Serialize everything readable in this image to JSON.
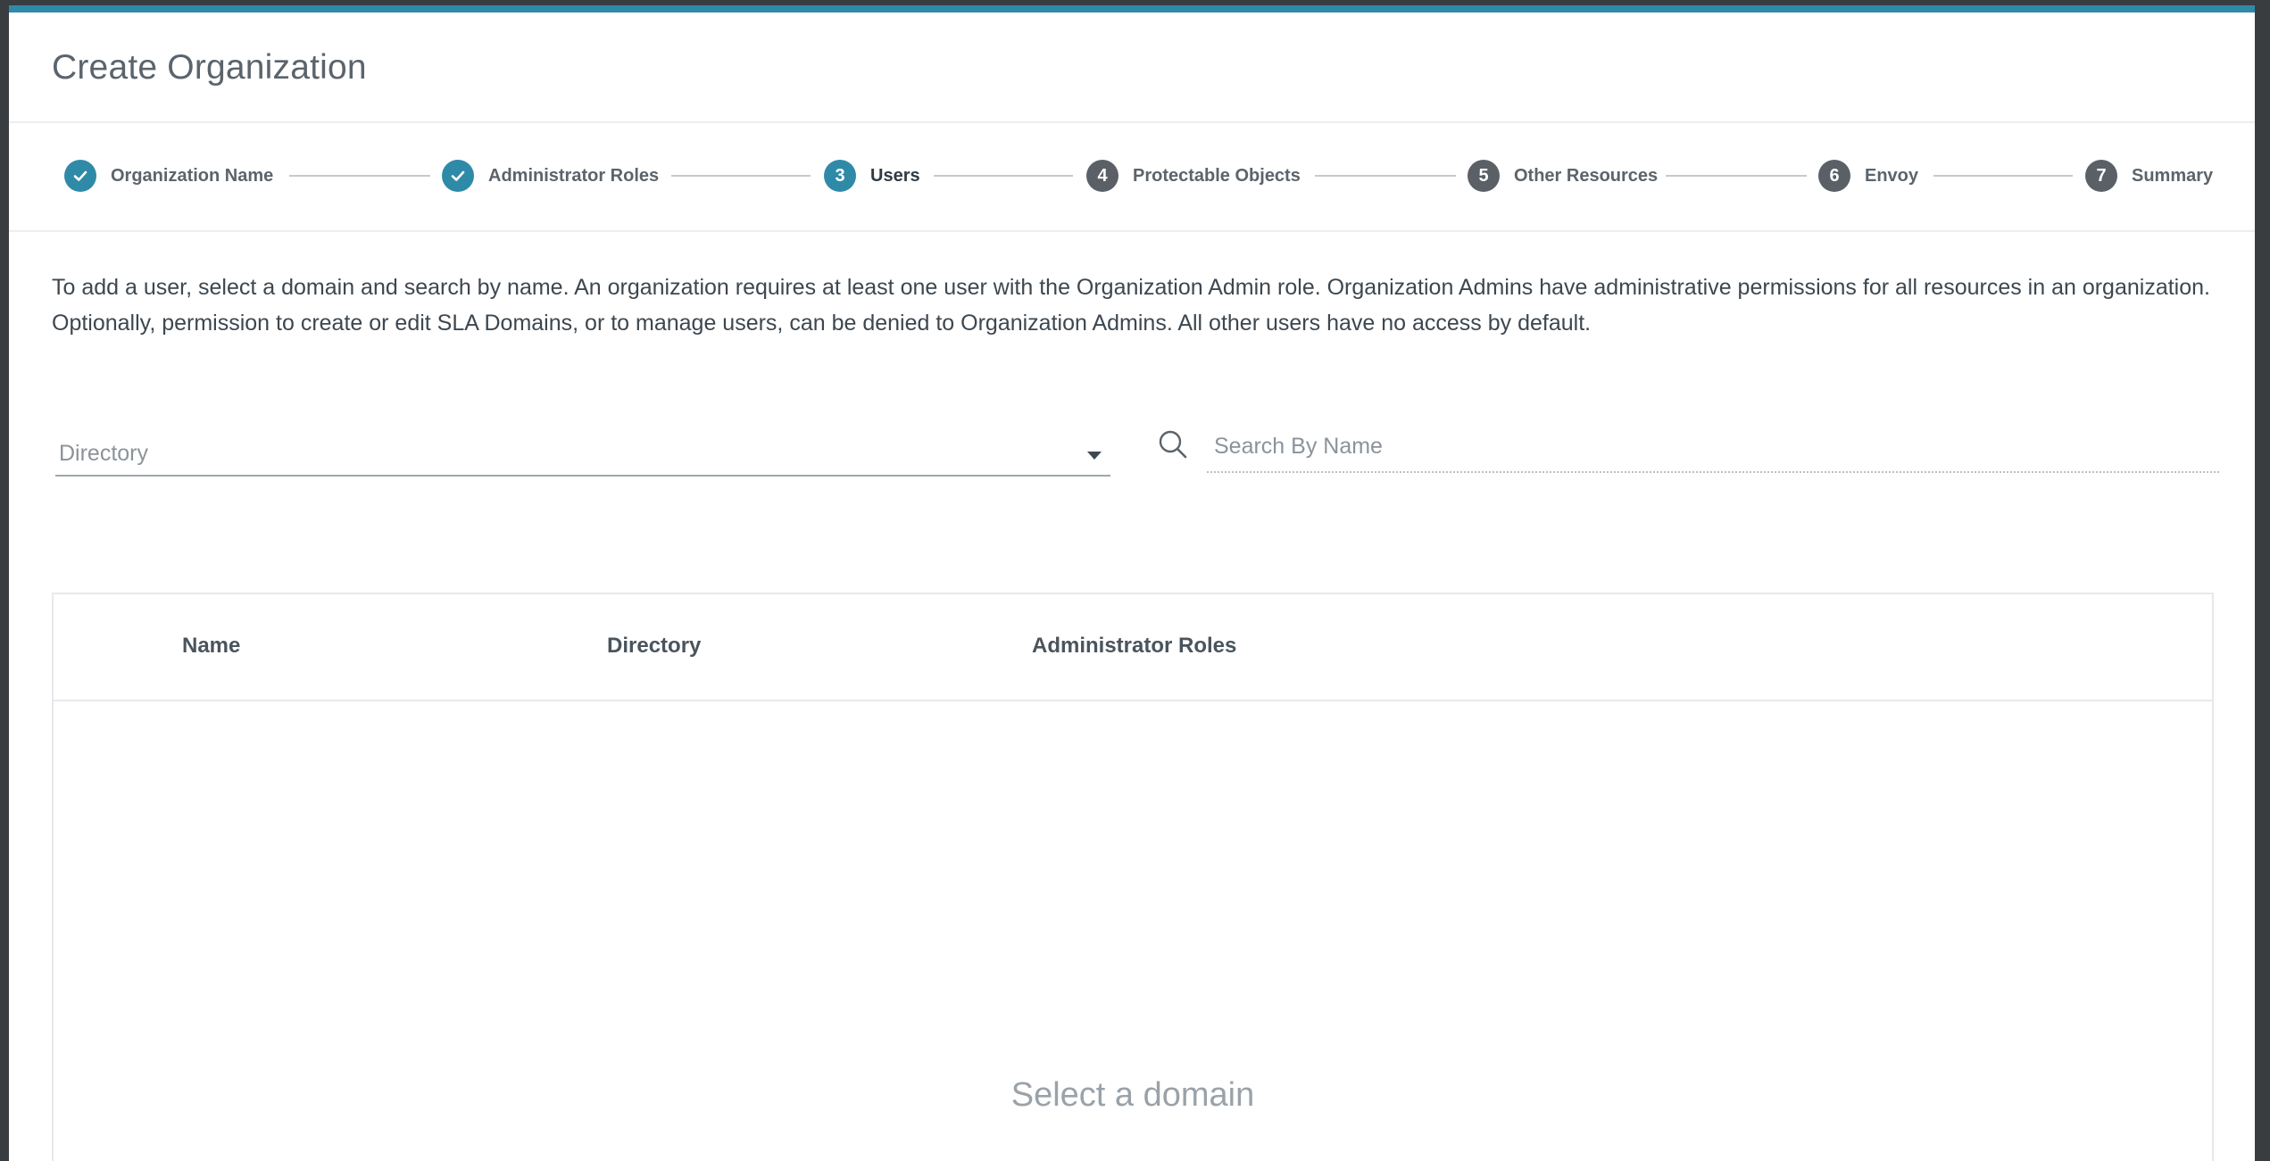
{
  "modal": {
    "title": "Create Organization"
  },
  "stepper": {
    "steps": [
      {
        "label": "Organization Name",
        "state": "done",
        "number": "1"
      },
      {
        "label": "Administrator Roles",
        "state": "done",
        "number": "2"
      },
      {
        "label": "Users",
        "state": "active",
        "number": "3"
      },
      {
        "label": "Protectable Objects",
        "state": "pending",
        "number": "4"
      },
      {
        "label": "Other Resources",
        "state": "pending",
        "number": "5"
      },
      {
        "label": "Envoy",
        "state": "pending",
        "number": "6"
      },
      {
        "label": "Summary",
        "state": "pending",
        "number": "7"
      }
    ]
  },
  "users": {
    "description": "To add a user, select a domain and search by name. An organization requires at least one user with the Organization Admin role. Organization Admins have administrative permissions for all resources in an organization. Optionally, permission to create or edit SLA Domains, or to manage users, can be denied to Organization Admins. All other users have no access by default.",
    "directory_select": {
      "placeholder": "Directory"
    },
    "search": {
      "placeholder": "Search By Name",
      "value": ""
    },
    "table": {
      "columns": [
        "Name",
        "Directory",
        "Administrator Roles"
      ],
      "rows": [],
      "empty_message": "Select a domain"
    }
  },
  "colors": {
    "accent": "#2f8aa8",
    "pending_step": "#5a6066",
    "backdrop": "#3a3d40"
  }
}
